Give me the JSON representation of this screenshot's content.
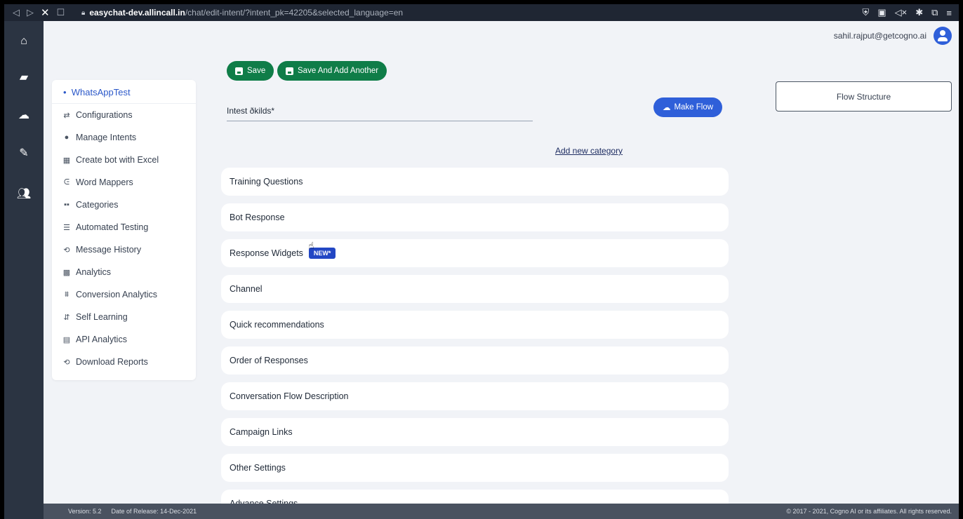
{
  "browser": {
    "nav_icons": [
      "◁",
      "▷",
      "✕",
      "☐"
    ],
    "lock_icon": "lock-icon",
    "url_host": "easychat-dev.allincall.in",
    "url_path": "/chat/edit-intent/?intent_pk=42205&selected_language=en",
    "extension_icons": [
      "shield-icon",
      "extension-icon",
      "mute-icon",
      "puzzle-icon",
      "window-icon",
      "menu-icon"
    ]
  },
  "rail": {
    "items": [
      "home-icon",
      "android-icon",
      "cloud-upload-icon",
      "edit-icon",
      "users-icon"
    ]
  },
  "user": {
    "email": "sahil.rajput@getcogno.ai"
  },
  "toolbar": {
    "save_label": "Save",
    "save_add_label": "Save And Add Another",
    "make_flow_label": "Make Flow"
  },
  "menu": {
    "bot_name": "WhatsAppTest",
    "items": [
      {
        "label": "Configurations",
        "icon": "sliders-icon"
      },
      {
        "label": "Manage Intents",
        "icon": "chat-icon"
      },
      {
        "label": "Create bot with Excel",
        "icon": "spreadsheet-icon"
      },
      {
        "label": "Word Mappers",
        "icon": "word-mapper-icon"
      },
      {
        "label": "Categories",
        "icon": "grid-icon"
      },
      {
        "label": "Automated Testing",
        "icon": "checklist-icon"
      },
      {
        "label": "Message History",
        "icon": "history-icon"
      },
      {
        "label": "Analytics",
        "icon": "analytics-icon"
      },
      {
        "label": "Conversion Analytics",
        "icon": "conversion-icon"
      },
      {
        "label": "Self Learning",
        "icon": "self-learning-icon"
      },
      {
        "label": "API Analytics",
        "icon": "api-icon"
      },
      {
        "label": "Download Reports",
        "icon": "download-history-icon"
      }
    ]
  },
  "form": {
    "intent_label": "Intest ðkilds",
    "required_mark": "*",
    "add_category": "Add new category"
  },
  "flow_structure": "Flow Structure",
  "sections": [
    {
      "label": "Training Questions"
    },
    {
      "label": "Bot Response"
    },
    {
      "label": "Response Widgets",
      "badge": "NEW*"
    },
    {
      "label": "Channel"
    },
    {
      "label": "Quick recommendations"
    },
    {
      "label": "Order of Responses"
    },
    {
      "label": "Conversation Flow Description"
    },
    {
      "label": "Campaign Links"
    },
    {
      "label": "Other Settings"
    },
    {
      "label": "Advance Settings"
    }
  ],
  "footer": {
    "version": "Version: 5.2",
    "release": "Date of Release: 14-Dec-2021",
    "copyright": "© 2017 - 2021, Cogno AI or its affiliates. All rights reserved."
  },
  "colors": {
    "save_green": "#0f7d48",
    "primary_blue": "#2f5fd9",
    "rail": "#2b3442",
    "page_bg": "#f1f3f7"
  }
}
